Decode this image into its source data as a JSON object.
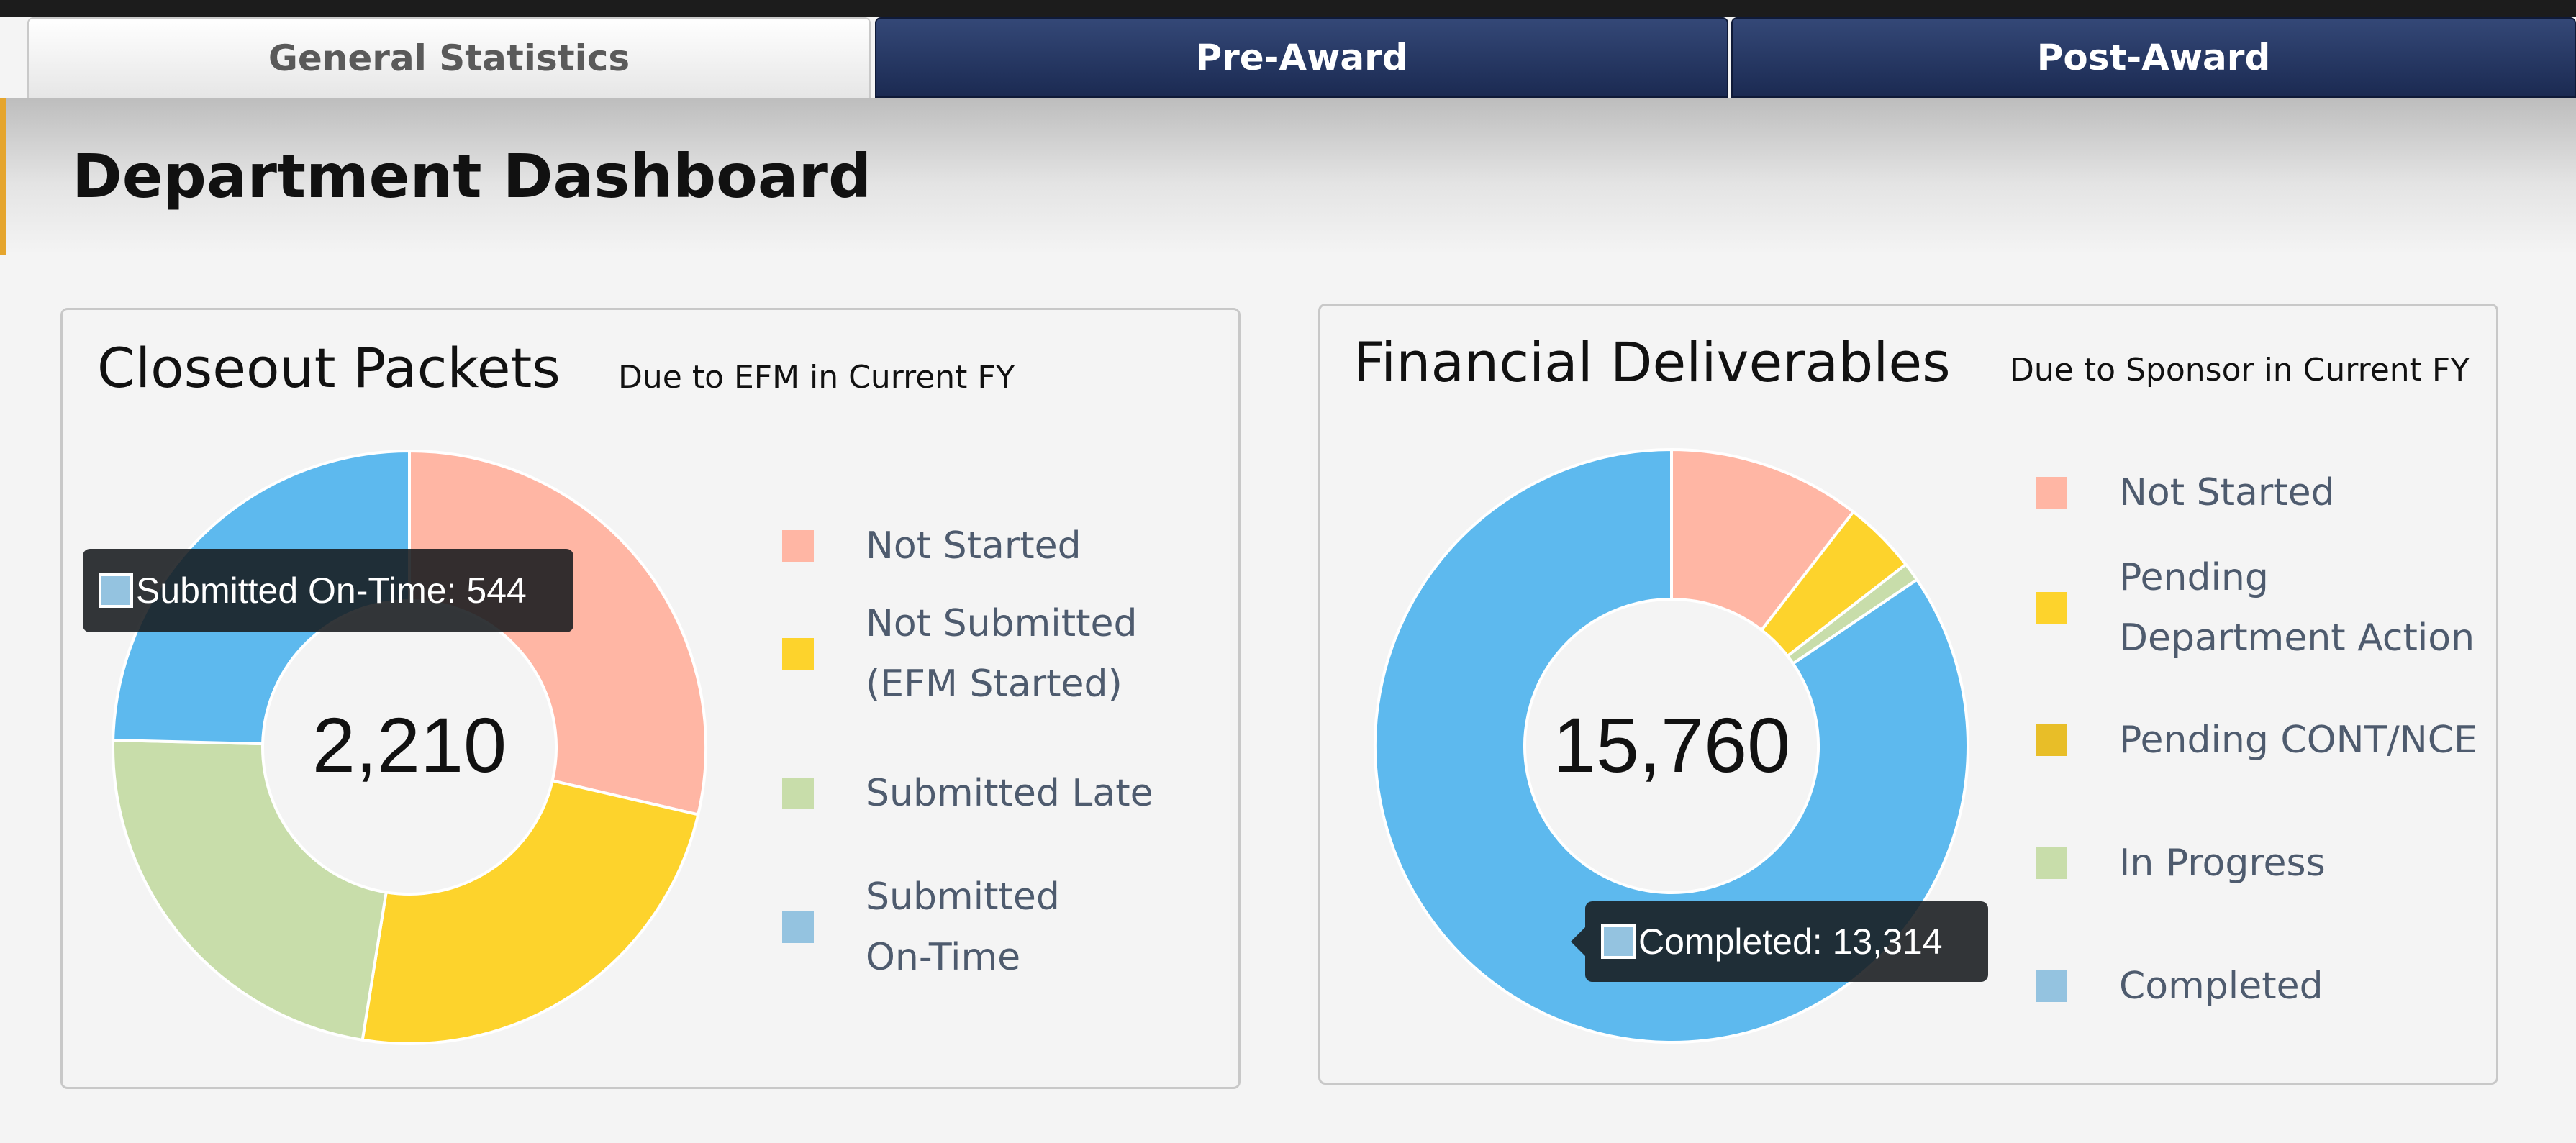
{
  "tabs": [
    {
      "label": "General Statistics"
    },
    {
      "label": "Pre-Award"
    },
    {
      "label": "Post-Award"
    }
  ],
  "page": {
    "title": "Department Dashboard"
  },
  "closeout": {
    "title": "Closeout Packets",
    "subtitle": "Due to EFM in Current FY",
    "total": "2,210",
    "tooltip": "Submitted On-Time: 544",
    "legend": [
      {
        "label_lines": [
          "Not Started"
        ],
        "color": "#FFB6A4"
      },
      {
        "label_lines": [
          "Not Submitted",
          "(EFM Started)"
        ],
        "color": "#FDD32C"
      },
      {
        "label_lines": [
          "Submitted Late"
        ],
        "color": "#C8DDAA"
      },
      {
        "label_lines": [
          "Submitted",
          "On-Time"
        ],
        "color": "#94C3E0"
      }
    ]
  },
  "financial": {
    "title": "Financial Deliverables",
    "subtitle": "Due to Sponsor in Current FY",
    "total": "15,760",
    "tooltip": "Completed: 13,314",
    "legend": [
      {
        "label_lines": [
          "Not Started"
        ],
        "color": "#FFB6A4"
      },
      {
        "label_lines": [
          "Pending",
          "Department Action"
        ],
        "color": "#FDD32C"
      },
      {
        "label_lines": [
          "Pending CONT/NCE"
        ],
        "color": "#E8BE28"
      },
      {
        "label_lines": [
          "In Progress"
        ],
        "color": "#C8DDAA"
      },
      {
        "label_lines": [
          "Completed"
        ],
        "color": "#94C3E0"
      }
    ]
  },
  "chart_data": [
    {
      "type": "pie",
      "title": "Closeout Packets",
      "subtitle": "Due to EFM in Current FY",
      "center_label": "2,210",
      "categories": [
        "Not Started",
        "Not Submitted (EFM Started)",
        "Submitted Late",
        "Submitted On-Time"
      ],
      "values": [
        633,
        528,
        505,
        544
      ],
      "colors": [
        "#FFB6A4",
        "#FDD32C",
        "#C8DDAA",
        "#5DB9EE"
      ],
      "legend_position": "right"
    },
    {
      "type": "pie",
      "title": "Financial Deliverables",
      "subtitle": "Due to Sponsor in Current FY",
      "center_label": "15,760",
      "categories": [
        "Not Started",
        "Pending Department Action",
        "Pending CONT/NCE",
        "In Progress",
        "Completed"
      ],
      "values": [
        1656,
        630,
        0,
        160,
        13314
      ],
      "colors": [
        "#FFB6A4",
        "#FDD32C",
        "#E8BE28",
        "#C8DDAA",
        "#5DB9EE"
      ],
      "legend_position": "right"
    }
  ]
}
